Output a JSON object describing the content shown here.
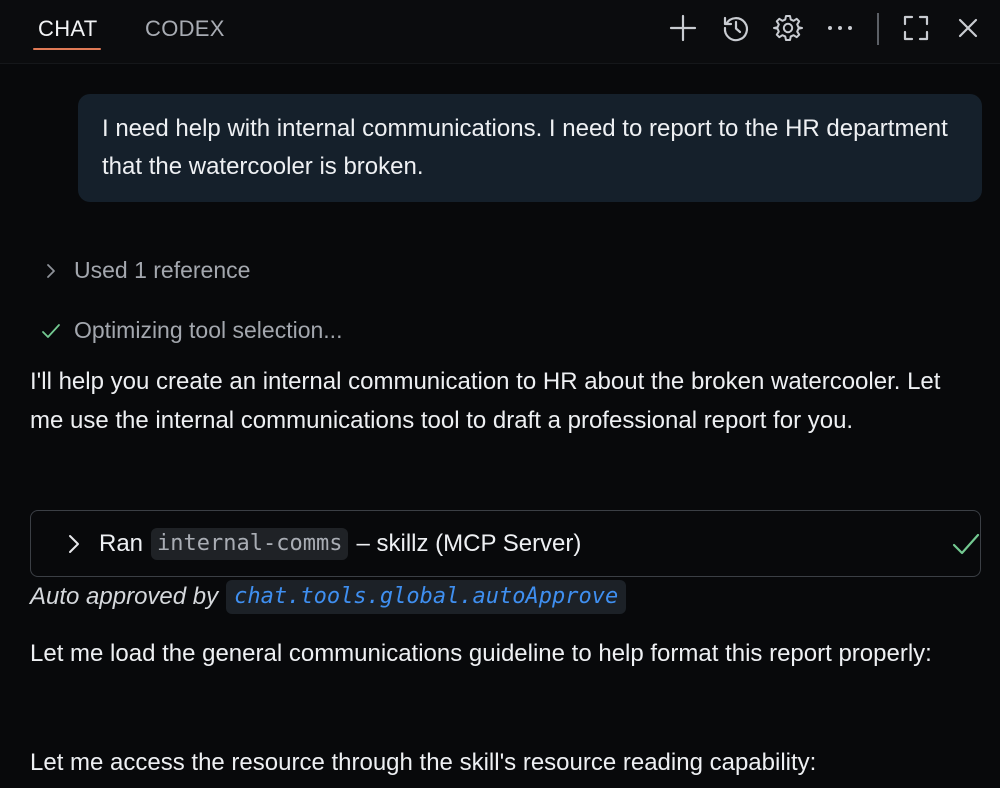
{
  "header": {
    "tabs": [
      {
        "label": "CHAT",
        "active": true
      },
      {
        "label": "CODEX",
        "active": false
      }
    ],
    "actions": [
      {
        "icon": "plus-icon",
        "label": "New chat"
      },
      {
        "icon": "history-icon",
        "label": "History"
      },
      {
        "icon": "gear-icon",
        "label": "Settings"
      },
      {
        "icon": "more-icon",
        "label": "More"
      },
      {
        "icon": "maximize-icon",
        "label": "Maximize"
      },
      {
        "icon": "close-icon",
        "label": "Close"
      }
    ],
    "accent_color": "#e07a56"
  },
  "conversation": {
    "user_message": "I need help with internal communications. I need to report to the HR department that the watercooler is broken.",
    "references_label": "Used 1 reference",
    "optimizing_label": "Optimizing tool selection...",
    "assistant_intro": "I'll help you create an internal communication to HR about the broken watercooler. Let me use the internal communications tool to draft a professional report for you.",
    "tool_call": {
      "prefix": "Ran",
      "tool_name": "internal-comms",
      "suffix": "– skillz (MCP Server)",
      "status": "success",
      "status_color": "#73c991"
    },
    "auto_approved_label": "Auto approved by",
    "auto_approved_setting": "chat.tools.global.autoApprove",
    "assistant_followup_1": "Let me load the general communications guideline to help format this report properly:",
    "assistant_followup_2": "Let me access the resource through the skill's resource reading capability:"
  }
}
